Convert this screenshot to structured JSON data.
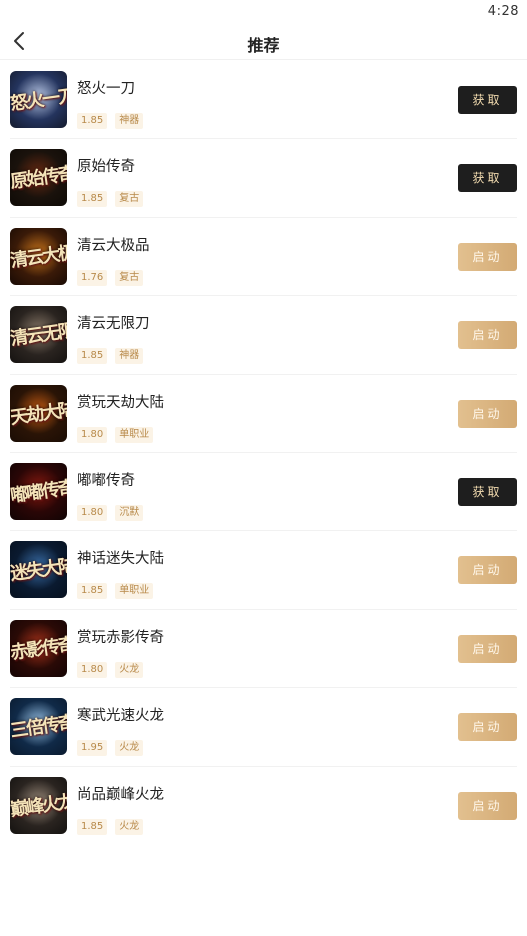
{
  "status": {
    "time": "4:28"
  },
  "header": {
    "title": "推荐",
    "back_icon": "chevron-left-icon"
  },
  "colors": {
    "get_button": "#1e1e1e",
    "launch_button": "#d9b482",
    "tag_text": "#b88a4a",
    "tag_bg": "#fbf3e6"
  },
  "games": [
    {
      "name": "怒火一刀",
      "version": "1.85",
      "tag": "神器",
      "action": "获取",
      "action_type": "get",
      "thumb_text": "怒火一刀",
      "thumb_bg": [
        "#24345e",
        "#b9c8e6",
        "#141a2c"
      ]
    },
    {
      "name": "原始传奇",
      "version": "1.85",
      "tag": "复古",
      "action": "获取",
      "action_type": "get",
      "thumb_text": "原始传奇",
      "thumb_bg": [
        "#1a120c",
        "#6a2a12",
        "#0e0a06"
      ]
    },
    {
      "name": "清云大极品",
      "version": "1.76",
      "tag": "复古",
      "action": "启动",
      "action_type": "launch",
      "thumb_text": "清云大极品",
      "thumb_bg": [
        "#3a1a08",
        "#c8741a",
        "#180a04"
      ]
    },
    {
      "name": "清云无限刀",
      "version": "1.85",
      "tag": "神器",
      "action": "启动",
      "action_type": "launch",
      "thumb_text": "清云无限刀",
      "thumb_bg": [
        "#2a2420",
        "#8a7a6a",
        "#151210"
      ]
    },
    {
      "name": "赏玩天劫大陆",
      "version": "1.80",
      "tag": "单职业",
      "action": "启动",
      "action_type": "launch",
      "thumb_text": "天劫大陆",
      "thumb_bg": [
        "#2a1406",
        "#c25a12",
        "#1a0c04"
      ]
    },
    {
      "name": "嘟嘟传奇",
      "version": "1.80",
      "tag": "沉默",
      "action": "获取",
      "action_type": "get",
      "thumb_text": "嘟嘟传奇",
      "thumb_bg": [
        "#2a0606",
        "#8a1a10",
        "#100404"
      ]
    },
    {
      "name": "神话迷失大陆",
      "version": "1.85",
      "tag": "单职业",
      "action": "启动",
      "action_type": "launch",
      "thumb_text": "迷失大陆",
      "thumb_bg": [
        "#0a1a30",
        "#3a6ea8",
        "#06101e"
      ]
    },
    {
      "name": "赏玩赤影传奇",
      "version": "1.80",
      "tag": "火龙",
      "action": "启动",
      "action_type": "launch",
      "thumb_text": "赤影传奇",
      "thumb_bg": [
        "#2a0a06",
        "#a8321a",
        "#140404"
      ]
    },
    {
      "name": "寒武光速火龙",
      "version": "1.95",
      "tag": "火龙",
      "action": "启动",
      "action_type": "launch",
      "thumb_text": "三倍传奇",
      "thumb_bg": [
        "#102a48",
        "#9ac4e8",
        "#0a1a2e"
      ]
    },
    {
      "name": "尚品巅峰火龙",
      "version": "1.85",
      "tag": "火龙",
      "action": "启动",
      "action_type": "launch",
      "thumb_text": "巅峰火龙",
      "thumb_bg": [
        "#2a2420",
        "#9a8a7a",
        "#141210"
      ]
    }
  ]
}
